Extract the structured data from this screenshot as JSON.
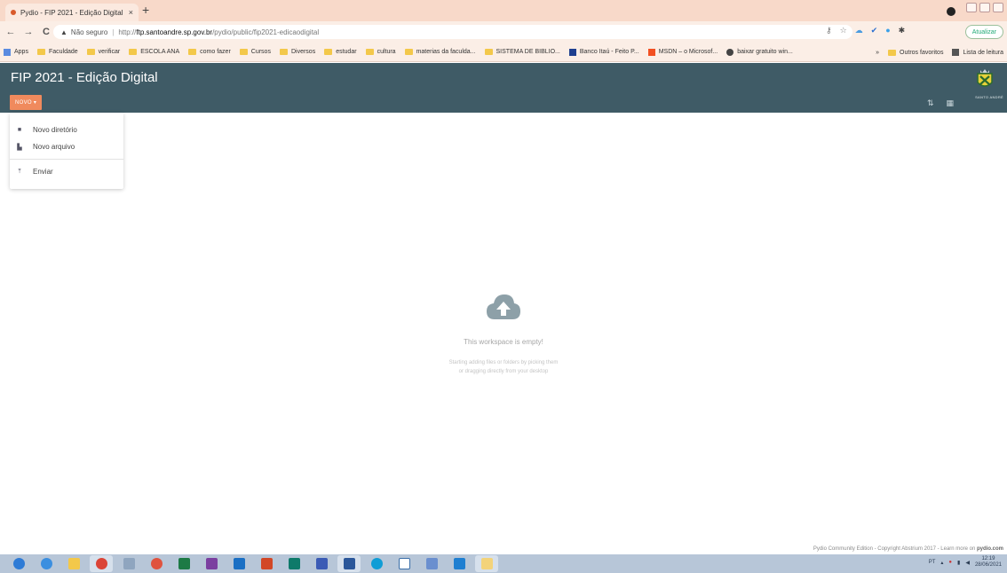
{
  "browser": {
    "tab_title": "Pydio - FIP 2021 - Edição Digital",
    "tab_close": "×",
    "new_tab": "+",
    "security_label": "Não seguro",
    "url_prefix": "http://",
    "url_host": "ftp.santoandre.sp.gov.br",
    "url_path": "/pydio/public/fip2021-edicaodigital",
    "update_button": "Atualizar",
    "bookmarks": [
      "Apps",
      "Faculdade",
      "verificar",
      "ESCOLA ANA",
      "como fazer",
      "Cursos",
      "Diversos",
      "estudar",
      "cultura",
      "materias da faculda...",
      "SISTEMA DE BIBLIO...",
      "Banco Itaú - Feito P...",
      "MSDN – o Microsof...",
      "baixar gratuito win..."
    ],
    "bookmarks_right": [
      "»",
      "Outros favoritos",
      "Lista de leitura"
    ]
  },
  "app": {
    "title": "FIP 2021 - Edição Digital",
    "new_button": "NOVO ▾",
    "logo_caption": "SANTO ANDRÉ",
    "accent_color": "#f08a5d",
    "header_color": "#3f5b66"
  },
  "dropdown": {
    "items": [
      {
        "label": "Novo diretório",
        "icon": "folder-plus-icon"
      },
      {
        "label": "Novo arquivo",
        "icon": "file-plus-icon"
      },
      {
        "label": "Enviar",
        "icon": "upload-icon"
      }
    ]
  },
  "empty_state": {
    "title": "This workspace is empty!",
    "line1": "Starting adding files or folders by picking them",
    "line2": "or dragging directly from your desktop"
  },
  "footer": {
    "text": "Pydio Community Edition - Copyright Abstrium 2017 - Learn more on ",
    "link": "pydio.com"
  },
  "taskbar": {
    "language": "PT",
    "time": "12:19",
    "date": "28/06/2021"
  }
}
